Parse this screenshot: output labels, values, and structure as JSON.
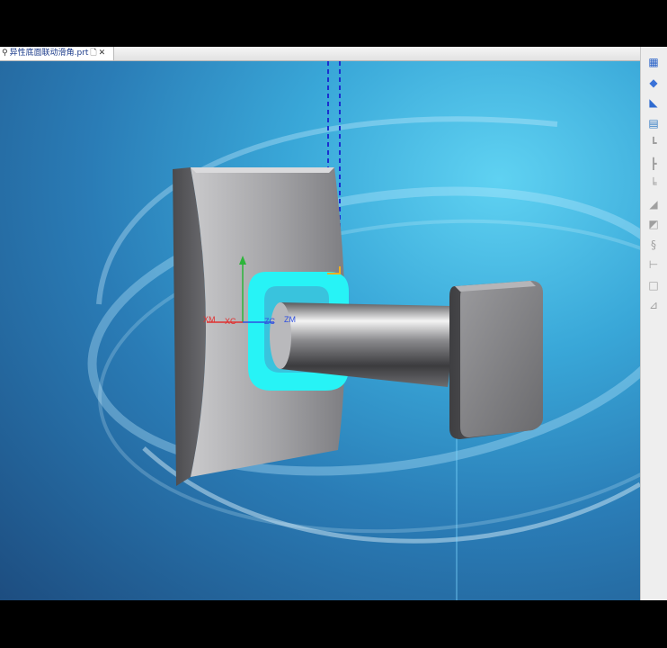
{
  "tab": {
    "label": "异性底面联动滑角.prt",
    "icon": "part-file-icon",
    "dirty_marker": "🗋",
    "close_glyph": "✕"
  },
  "axes": {
    "xm": "XM",
    "xc": "XC",
    "zc": "ZC",
    "zm": "ZM"
  },
  "toolbar": {
    "buttons": [
      {
        "name": "extrude-feature-icon",
        "glyph": "▦",
        "color": "#2a63c9"
      },
      {
        "name": "block-feature-icon",
        "glyph": "◆",
        "color": "#3a72d8"
      },
      {
        "name": "boss-feature-icon",
        "glyph": "◣",
        "color": "#2f6bd0"
      },
      {
        "name": "pattern-feature-icon",
        "glyph": "▤",
        "color": "#3a80c6"
      },
      {
        "name": "step-feature-icon",
        "glyph": "┗",
        "color": "#a0a0a0"
      },
      {
        "name": "edge-blend-icon",
        "glyph": "┣",
        "color": "#a0a0a0"
      },
      {
        "name": "chamfer-icon",
        "glyph": "╘",
        "color": "#a0a0a0"
      },
      {
        "name": "draft-icon",
        "glyph": "◢",
        "color": "#a0a0a0"
      },
      {
        "name": "shell-icon",
        "glyph": "◩",
        "color": "#a0a0a0"
      },
      {
        "name": "offset-face-icon",
        "glyph": "§",
        "color": "#a0a0a0"
      },
      {
        "name": "trim-body-icon",
        "glyph": "⊢",
        "color": "#a0a0a0"
      },
      {
        "name": "sketch-frame-icon",
        "glyph": "□",
        "color": "#a0a0a0"
      },
      {
        "name": "measure-icon",
        "glyph": "⊿",
        "color": "#a0a0a0"
      }
    ]
  }
}
